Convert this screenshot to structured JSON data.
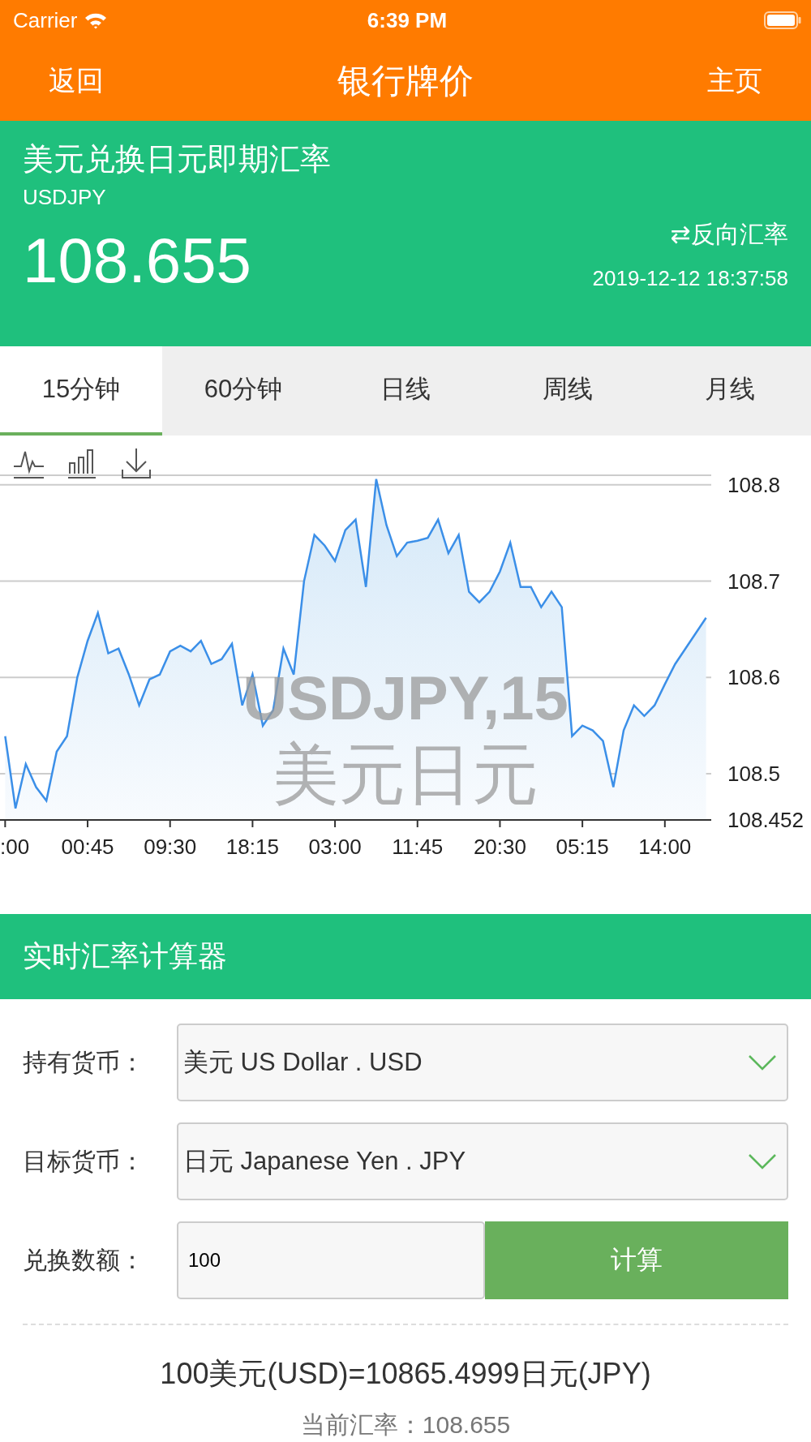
{
  "status_bar": {
    "carrier": "Carrier",
    "time": "6:39 PM"
  },
  "nav": {
    "back": "返回",
    "title": "银行牌价",
    "home": "主页"
  },
  "quote": {
    "title": "美元兑换日元即期汇率",
    "symbol": "USDJPY",
    "price": "108.655",
    "reverse": "⇄反向汇率",
    "timestamp": "2019-12-12 18:37:58"
  },
  "tabs": [
    {
      "label": "15分钟",
      "selected": true
    },
    {
      "label": "60分钟",
      "selected": false
    },
    {
      "label": "日线",
      "selected": false
    },
    {
      "label": "周线",
      "selected": false
    },
    {
      "label": "月线",
      "selected": false
    }
  ],
  "chart": {
    "watermark": [
      "USDJPY,15",
      "美元日元"
    ],
    "chart_data": {
      "type": "area",
      "categories": [
        ":00",
        null,
        null,
        null,
        null,
        null,
        null,
        null,
        "00:45",
        null,
        null,
        null,
        null,
        null,
        null,
        null,
        "09:30",
        null,
        null,
        null,
        null,
        null,
        null,
        null,
        "18:15",
        null,
        null,
        null,
        null,
        null,
        null,
        null,
        "03:00",
        null,
        null,
        null,
        null,
        null,
        null,
        null,
        "11:45",
        null,
        null,
        null,
        null,
        null,
        null,
        null,
        "20:30",
        null,
        null,
        null,
        null,
        null,
        null,
        null,
        "05:15",
        null,
        null,
        null,
        null,
        null,
        null,
        null,
        "14:00",
        null,
        null,
        null,
        null
      ],
      "grid": true,
      "series": [
        {
          "color": "#3b8fe8",
          "values": [
            108.539,
            108.464,
            108.51,
            108.486,
            108.472,
            108.523,
            108.539,
            108.6,
            108.638,
            108.667,
            108.625,
            108.63,
            108.603,
            108.571,
            108.598,
            108.603,
            108.627,
            108.633,
            108.627,
            108.638,
            108.614,
            108.619,
            108.635,
            108.571,
            108.603,
            108.55,
            108.566,
            108.63,
            108.603,
            108.7,
            108.748,
            108.737,
            108.721,
            108.753,
            108.764,
            108.694,
            108.806,
            108.758,
            108.726,
            108.74,
            108.742,
            108.745,
            108.764,
            108.729,
            108.748,
            108.689,
            108.678,
            108.689,
            108.71,
            108.74,
            108.694,
            108.694,
            108.673,
            108.689,
            108.673,
            108.539,
            108.55,
            108.545,
            108.534,
            108.486,
            108.545,
            108.571,
            108.56,
            108.571,
            108.593,
            108.614,
            108.63,
            108.646,
            108.662
          ]
        }
      ],
      "ylim": [
        108.452,
        108.81
      ],
      "yticks": [
        108.452,
        108.5,
        108.6,
        108.7,
        108.8
      ]
    }
  },
  "calculator": {
    "title": "实时汇率计算器",
    "rows": [
      {
        "kind": "select",
        "label": "持有货币：",
        "value": "美元 US Dollar . USD"
      },
      {
        "kind": "select",
        "label": "目标货币：",
        "value": "日元 Japanese Yen . JPY"
      },
      {
        "kind": "amount",
        "label": "兑换数额：",
        "value": "100",
        "button": "计算"
      }
    ],
    "result": "100美元(USD)=10865.4999日元(JPY)",
    "current_rate": "当前汇率：108.655"
  }
}
